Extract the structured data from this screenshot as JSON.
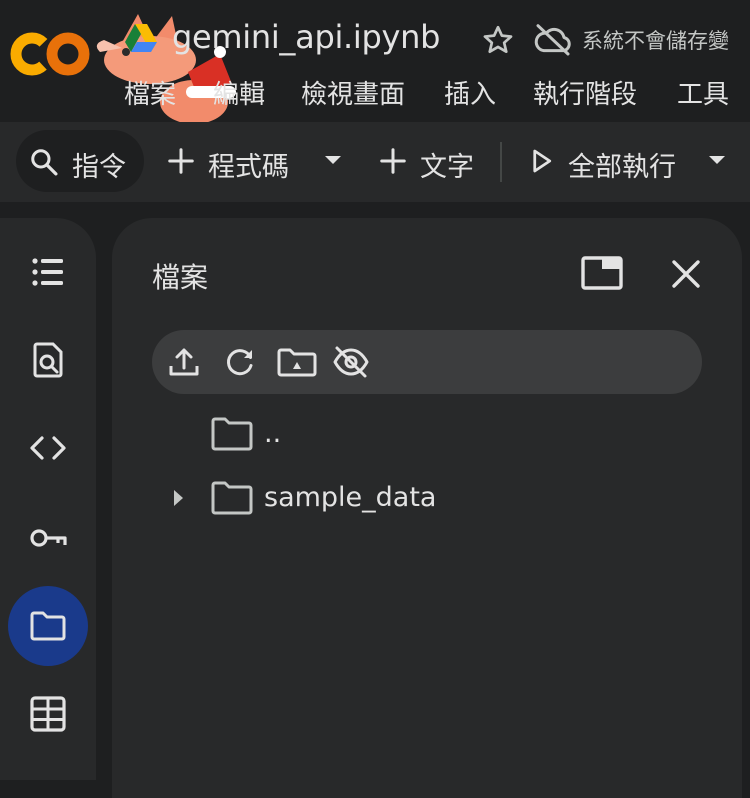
{
  "app": {
    "logo_text": "CO",
    "notebook_title": "gemini_api.ipynb",
    "save_status": "系統不會儲存變",
    "brand_color": "#f9ab00"
  },
  "menu": {
    "items": [
      "檔案",
      "編輯",
      "檢視畫面",
      "插入",
      "執行階段",
      "工具"
    ]
  },
  "toolbar": {
    "command_label": "指令",
    "code_label": "程式碼",
    "text_label": "文字",
    "run_all_label": "全部執行"
  },
  "rail": {
    "items": [
      {
        "icon": "table-of-contents-icon"
      },
      {
        "icon": "find-replace-icon"
      },
      {
        "icon": "code-snippets-icon"
      },
      {
        "icon": "secrets-key-icon"
      },
      {
        "icon": "files-folder-icon",
        "active": true
      },
      {
        "icon": "variables-table-icon"
      }
    ],
    "active_color": "#1a3a8b"
  },
  "files_panel": {
    "title": "檔案",
    "toolbar_icons": [
      "upload-icon",
      "refresh-icon",
      "mount-drive-icon",
      "hide-files-icon"
    ],
    "entries": [
      {
        "name": "..",
        "expandable": false
      },
      {
        "name": "sample_data",
        "expandable": true
      }
    ]
  }
}
